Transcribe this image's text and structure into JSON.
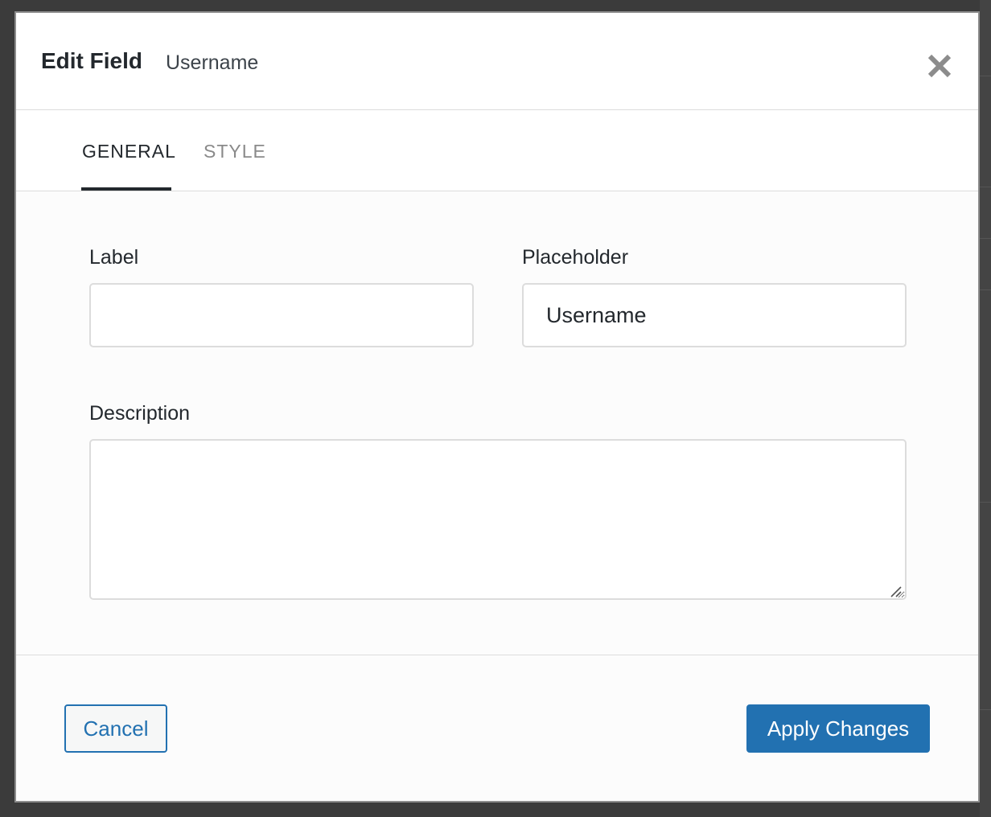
{
  "modal": {
    "title": "Edit Field",
    "subtitle": "Username"
  },
  "tabs": [
    {
      "label": "GENERAL",
      "active": true
    },
    {
      "label": "STYLE",
      "active": false
    }
  ],
  "fields": {
    "label": {
      "label": "Label",
      "value": ""
    },
    "placeholder": {
      "label": "Placeholder",
      "value": "Username"
    },
    "description": {
      "label": "Description",
      "value": ""
    }
  },
  "footer": {
    "cancel_label": "Cancel",
    "apply_label": "Apply Changes"
  },
  "icons": {
    "close": "close-icon",
    "resize": "resize-handle-icon"
  },
  "colors": {
    "accent": "#2271b1",
    "text": "#23282d",
    "inactive_tab": "#8a8a8a",
    "close_icon": "#8c8c8c"
  }
}
